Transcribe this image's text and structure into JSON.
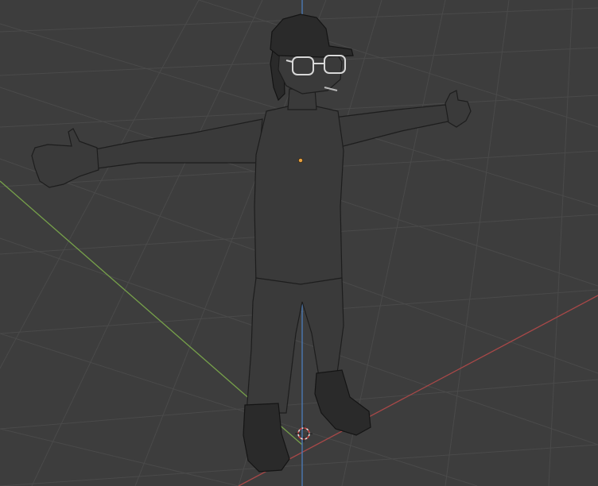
{
  "viewport": {
    "background": "#3d3d3d",
    "grid_color": "#4a4a4a",
    "axis_x_color": "#b04a4a",
    "axis_y_color": "#7aa04a",
    "axis_z_color": "#4a7ab4",
    "origin_color": "#e6a040",
    "icons": [
      "3d-cursor-icon",
      "object-origin-icon"
    ]
  }
}
